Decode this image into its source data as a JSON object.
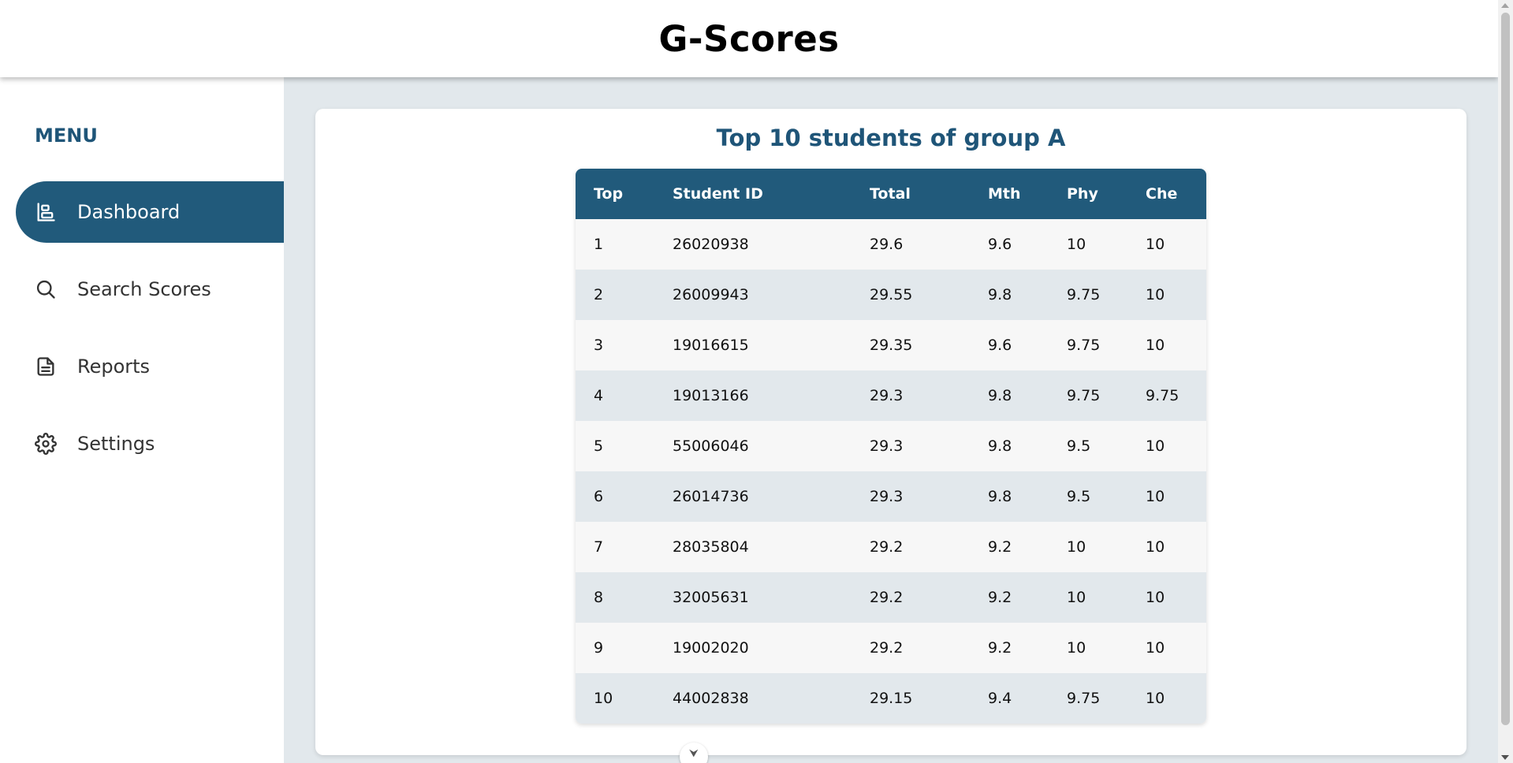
{
  "app": {
    "title": "G-Scores"
  },
  "sidebar": {
    "menu_label": "MENU",
    "items": [
      {
        "label": "Dashboard",
        "icon": "dashboard-icon",
        "active": true
      },
      {
        "label": "Search Scores",
        "icon": "search-icon",
        "active": false
      },
      {
        "label": "Reports",
        "icon": "document-icon",
        "active": false
      },
      {
        "label": "Settings",
        "icon": "gear-icon",
        "active": false
      }
    ]
  },
  "main": {
    "title": "Top 10 students of group A",
    "table": {
      "headers": [
        "Top",
        "Student ID",
        "Total",
        "Mth",
        "Phy",
        "Che"
      ],
      "rows": [
        [
          "1",
          "26020938",
          "29.6",
          "9.6",
          "10",
          "10"
        ],
        [
          "2",
          "26009943",
          "29.55",
          "9.8",
          "9.75",
          "10"
        ],
        [
          "3",
          "19016615",
          "29.35",
          "9.6",
          "9.75",
          "10"
        ],
        [
          "4",
          "19013166",
          "29.3",
          "9.8",
          "9.75",
          "9.75"
        ],
        [
          "5",
          "55006046",
          "29.3",
          "9.8",
          "9.5",
          "10"
        ],
        [
          "6",
          "26014736",
          "29.3",
          "9.8",
          "9.5",
          "10"
        ],
        [
          "7",
          "28035804",
          "29.2",
          "9.2",
          "10",
          "10"
        ],
        [
          "8",
          "32005631",
          "29.2",
          "9.2",
          "10",
          "10"
        ],
        [
          "9",
          "19002020",
          "29.2",
          "9.2",
          "10",
          "10"
        ],
        [
          "10",
          "44002838",
          "29.15",
          "9.4",
          "9.75",
          "10"
        ]
      ]
    }
  },
  "colors": {
    "accent": "#215a7b",
    "background": "#e2e8ec",
    "row_alt": "#f7f7f7"
  }
}
